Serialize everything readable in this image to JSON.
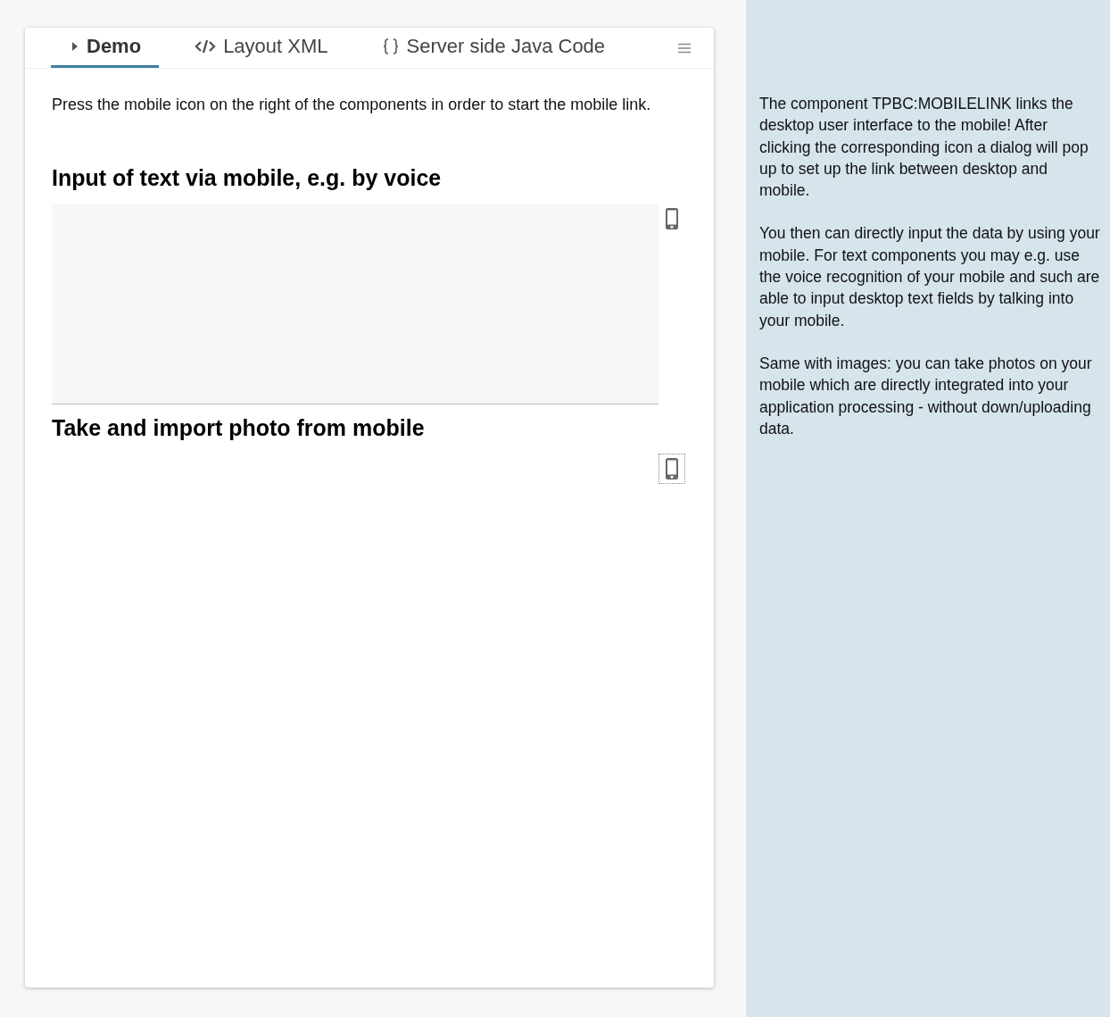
{
  "tabs": [
    {
      "label": "Demo",
      "kind": "play",
      "selected": true
    },
    {
      "label": "Layout XML",
      "kind": "code",
      "selected": false
    },
    {
      "label": "Server side Java Code",
      "kind": "braces",
      "selected": false
    }
  ],
  "intro": "Press the mobile icon on the right of the components in order to start the mobile link.",
  "sections": [
    {
      "heading": "Input of text via mobile, e.g. by voice",
      "kind": "textarea",
      "focused": false
    },
    {
      "heading": "Take and import photo from mobile",
      "kind": "photo",
      "focused": true
    }
  ],
  "info": [
    "The component TPBC:MOBILELINK links the desktop user interface to the mobile! After clicking the corresponding icon a dialog will pop up to set up the link between desktop and mobile.",
    "You then can directly input the data by using your mobile. For text components you may e.g. use the voice recognition of your mobile and such are able to input desktop text fields by talking into your mobile.",
    "Same with images: you can take photos on your mobile which are directly integrated into your application processing - without down/uploading data."
  ]
}
